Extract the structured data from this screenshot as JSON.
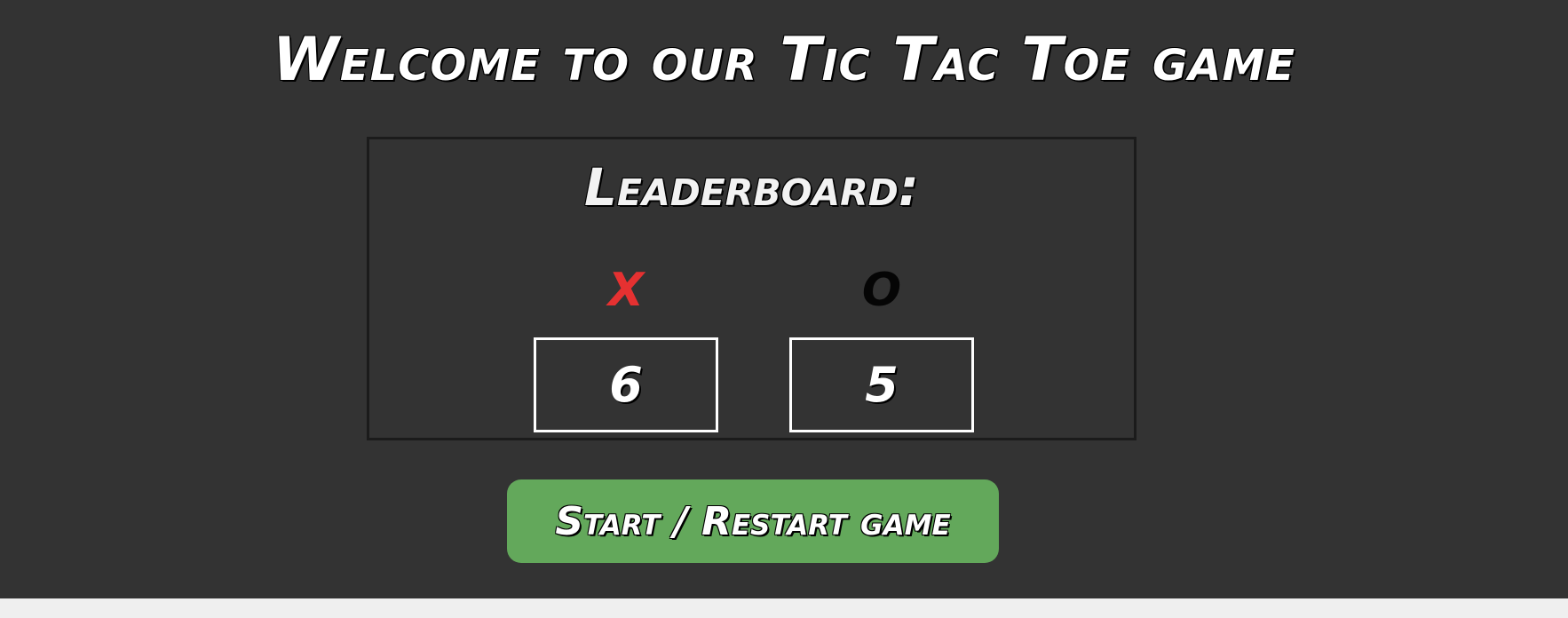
{
  "header": {
    "title": "Welcome to our Tic Tac Toe game"
  },
  "leaderboard": {
    "title": "Leaderboard:",
    "players": [
      {
        "symbol": "X",
        "score": "6",
        "color": "#e53131"
      },
      {
        "symbol": "O",
        "score": "5",
        "color": "#050505"
      }
    ]
  },
  "controls": {
    "start_label": "Start / Restart game"
  },
  "colors": {
    "background": "#333333",
    "button": "#63a85b",
    "border": "#ffffff"
  }
}
